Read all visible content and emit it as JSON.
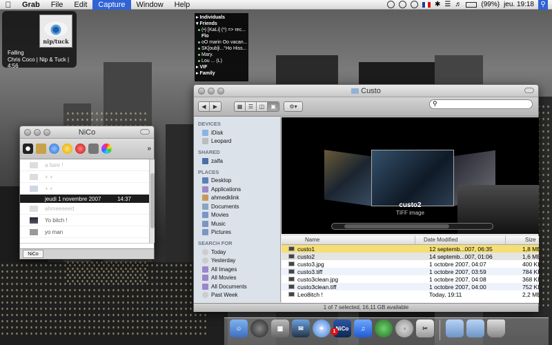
{
  "menubar": {
    "app": "Grab",
    "items": [
      "File",
      "Edit",
      "Capture",
      "Window",
      "Help"
    ],
    "active_item": "Capture",
    "battery": "(99%)",
    "clock": "jeu. 19:18"
  },
  "nowplaying": {
    "cover_text": "nip/tuck",
    "track": "Falling",
    "info": "Chris Coco | Nip & Tuck | 4:56"
  },
  "buddies": {
    "rows": [
      {
        "text": "Individuals",
        "kind": "group"
      },
      {
        "text": "Friends",
        "kind": "group"
      },
      {
        "text": "(•) [KaLi] (*) => rec...",
        "kind": "contact"
      },
      {
        "text": "Flo",
        "kind": "group-small"
      },
      {
        "text": "oO marin Oo vacan...",
        "kind": "contact"
      },
      {
        "text": "SK[oub]i...°Ho Hiss...",
        "kind": "contact"
      },
      {
        "text": "Mary.",
        "kind": "contact"
      },
      {
        "text": "Lou ... (L)",
        "kind": "contact"
      },
      {
        "text": "VIF",
        "kind": "group"
      },
      {
        "text": "Family",
        "kind": "group"
      }
    ]
  },
  "nico": {
    "title": "NiCo",
    "messages": [
      {
        "text": "a faire !",
        "light": true
      },
      {
        "text": "+ +",
        "light": true
      },
      {
        "text": "+ +",
        "light": true
      }
    ],
    "date_row": {
      "date": "jeudi 1 novembre 2007",
      "time": "14:37"
    },
    "messages_after": [
      {
        "text": "ahmeeeeed",
        "light": true
      },
      {
        "text": "Yo bitch !",
        "light": false
      },
      {
        "text": "yo man",
        "light": false
      }
    ],
    "tab": "NiCo"
  },
  "finder": {
    "title": "Custo",
    "sidebar": [
      {
        "head": "DEVICES",
        "items": [
          {
            "label": "iDisk",
            "icon": "disk-icon"
          },
          {
            "label": "Leopard",
            "icon": "harddrive-icon"
          }
        ]
      },
      {
        "head": "SHARED",
        "items": [
          {
            "label": "zalfa",
            "icon": "computer-icon"
          }
        ]
      },
      {
        "head": "PLACES",
        "items": [
          {
            "label": "Desktop",
            "icon": "desktop-icon"
          },
          {
            "label": "Applications",
            "icon": "applications-icon"
          },
          {
            "label": "ahmedklink",
            "icon": "home-icon"
          },
          {
            "label": "Documents",
            "icon": "documents-icon"
          },
          {
            "label": "Movies",
            "icon": "movies-icon"
          },
          {
            "label": "Music",
            "icon": "music-icon"
          },
          {
            "label": "Pictures",
            "icon": "pictures-icon"
          }
        ]
      },
      {
        "head": "SEARCH FOR",
        "items": [
          {
            "label": "Today",
            "icon": "clock-icon"
          },
          {
            "label": "Yesterday",
            "icon": "clock-icon"
          },
          {
            "label": "All Images",
            "icon": "folder-icon"
          },
          {
            "label": "All Movies",
            "icon": "folder-icon"
          },
          {
            "label": "All Documents",
            "icon": "folder-icon"
          },
          {
            "label": "Past Week",
            "icon": "clock-icon"
          }
        ]
      }
    ],
    "preview": {
      "name": "custo2",
      "kind": "TIFF image"
    },
    "columns": [
      "Name",
      "Date Modified",
      "Size"
    ],
    "files": [
      {
        "name": "custo1",
        "date": "12 septemb...007, 06:35",
        "size": "1,8 MB"
      },
      {
        "name": "custo2",
        "date": "14 septemb...007, 01:06",
        "size": "1,6 MB"
      },
      {
        "name": "custo3.jpg",
        "date": "1 octobre 2007, 04:07",
        "size": "400 KB"
      },
      {
        "name": "custo3.tiff",
        "date": "1 octobre 2007, 03:59",
        "size": "784 KB"
      },
      {
        "name": "custo3clean.jpg",
        "date": "1 octobre 2007, 04:08",
        "size": "368 KB"
      },
      {
        "name": "custo3clean.tiff",
        "date": "1 octobre 2007, 04:00",
        "size": "752 KB"
      },
      {
        "name": "Leo8itch !",
        "date": "Today, 19:11",
        "size": "2,2 MB"
      }
    ],
    "status": "1 of 7 selected, 16,11 GB available"
  },
  "dock": {
    "nico_badge": "NiCo",
    "nico_count": "1"
  }
}
